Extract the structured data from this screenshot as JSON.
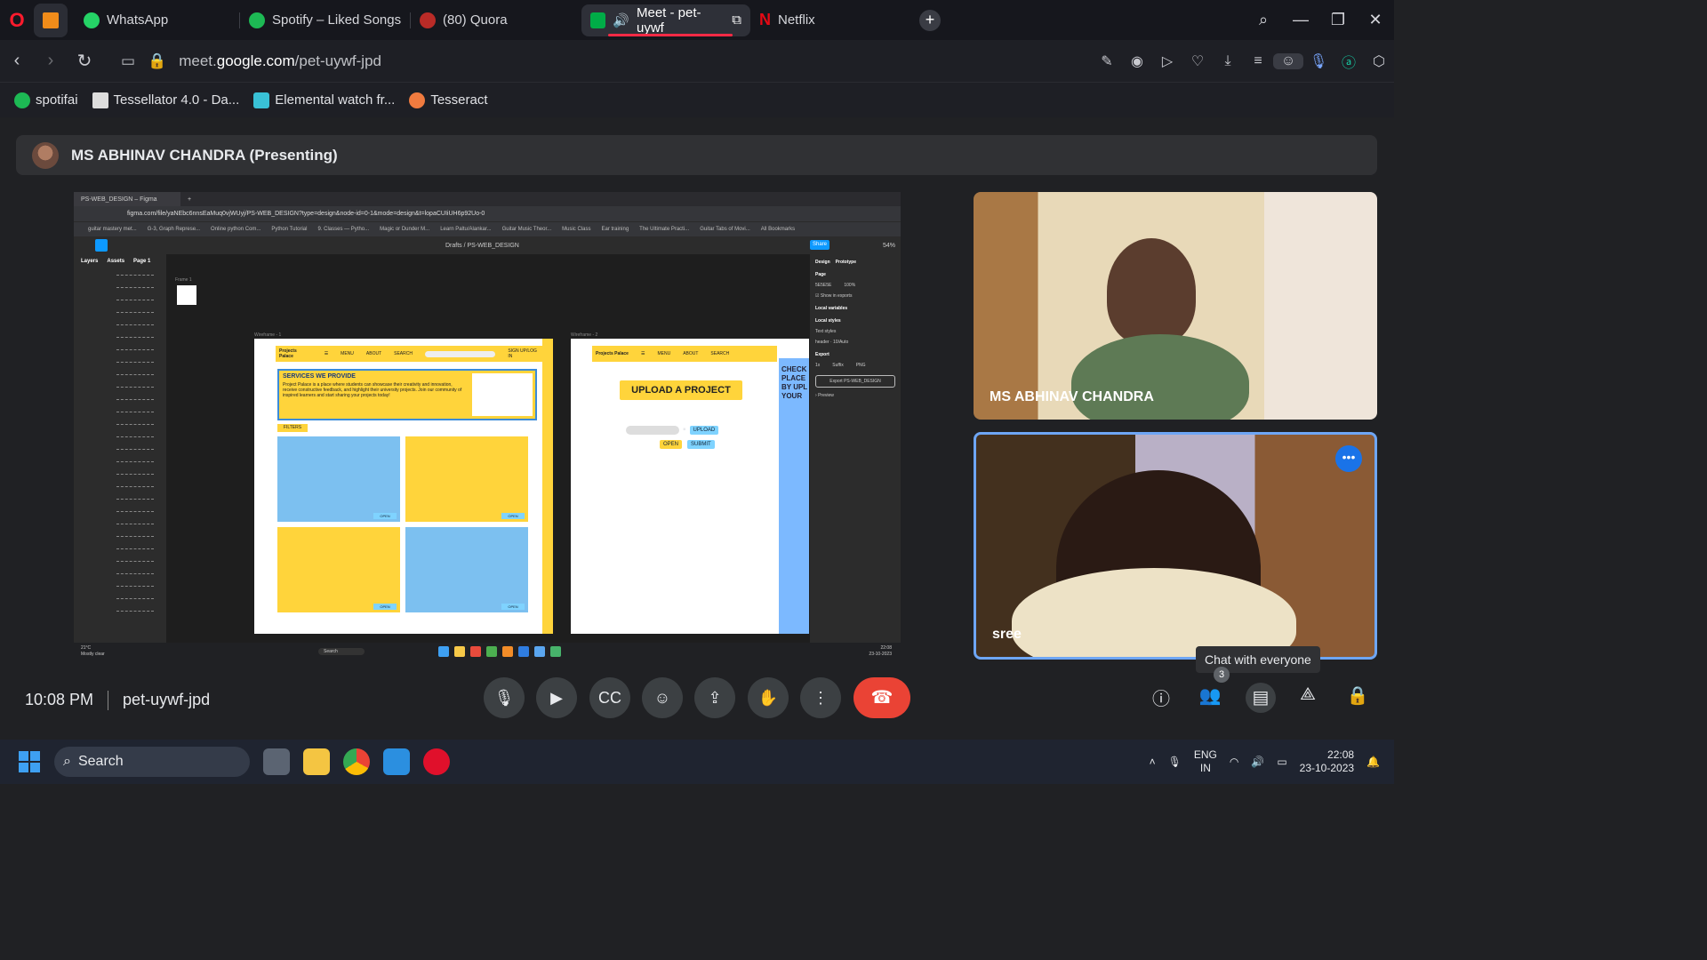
{
  "browser": {
    "tabs": [
      {
        "label": "WhatsApp",
        "icon": "whatsapp-icon",
        "color": "#25d366"
      },
      {
        "label": "Spotify – Liked Songs",
        "icon": "spotify-icon",
        "color": "#1db954"
      },
      {
        "label": "(80) Quora",
        "icon": "quora-icon",
        "color": "#b92b27"
      },
      {
        "label": "Meet - pet-uywf",
        "icon": "meet-icon",
        "color": "#00ac47",
        "active": true
      },
      {
        "label": "Netflix",
        "icon": "netflix-icon",
        "color": "#e50914"
      }
    ],
    "address": {
      "prefix": "meet.",
      "domain": "google.com",
      "path": "/pet-uywf-jpd"
    },
    "bookmarks": [
      {
        "label": "spotifai",
        "color": "#1db954"
      },
      {
        "label": "Tessellator 4.0 - Da...",
        "color": "#dddddd"
      },
      {
        "label": "Elemental watch fr...",
        "color": "#39c1d6"
      },
      {
        "label": "Tesseract",
        "color": "#f07b3f"
      }
    ]
  },
  "meet": {
    "presenter_banner": "MS ABHINAV CHANDRA (Presenting)",
    "time": "10:08 PM",
    "meeting_code": "pet-uywf-jpd",
    "participants": [
      {
        "name": "MS ABHINAV CHANDRA"
      },
      {
        "name": "sree"
      }
    ],
    "tooltip": "Chat with everyone",
    "people_count": "3"
  },
  "shared_screen": {
    "tab_title": "PS-WEB_DESIGN – Figma",
    "url": "figma.com/file/yaNEbc6nnsEaMuq0vjWUyj/PS-WEB_DESIGN?type=design&node-id=0-1&mode=design&t=lopaCUIiUH6p92Uo-0",
    "bookmarks": [
      "guitar mastery met...",
      "G-3, Graph Represe...",
      "Online python Com...",
      "Python Tutorial",
      "9. Classes — Pytho...",
      "Magic or Dunder M...",
      "Learn Paltu/Alankar...",
      "Guitar Music Theor...",
      "Music Class",
      "Ear training",
      "The Ultimate Practi...",
      "Guitar Tabs of Movi...",
      "All Bookmarks"
    ],
    "breadcrumb": "Drafts / PS-WEB_DESIGN",
    "zoom": "54%",
    "share_label": "Share",
    "left_tabs": [
      "Layers",
      "Assets",
      "Page 1"
    ],
    "right_panel": {
      "tabs": [
        "Design",
        "Prototype"
      ],
      "page": "Page",
      "page_color": "5E5E5E",
      "opacity": "100%",
      "show_exports": "Show in exports",
      "local_variables": "Local variables",
      "local_styles": "Local styles",
      "text_styles": "Text styles",
      "text_style_item": "header · 10/Auto",
      "export": "Export",
      "export_scale": "1x",
      "export_suffix": "Suffix",
      "export_format": "PNG",
      "export_button": "Export PS-WEB_DESIGN",
      "preview": "Preview"
    },
    "frame_label": "Frame 1",
    "wireframe1_label": "Wireframe - 1",
    "wireframe2_label": "Wireframe - 2",
    "wf1": {
      "logo": "Projects Palace",
      "menu": "MENU",
      "about": "ABOUT",
      "search": "SEARCH",
      "signup": "SIGN UP/LOG IN",
      "services_title": "SERVICES WE PROVIDE",
      "services_text": "Project Palace is a place where students can showcase their creativity and innovation, receive constructive feedback, and highlight their university projects. Join our community of inspired learners and start sharing your projects today!",
      "filters": "FILTERS",
      "open": "OPEN"
    },
    "wf2": {
      "logo": "Projects Palace",
      "menu": "MENU",
      "about": "ABOUT",
      "search": "SEARCH",
      "upload_title": "UPLOAD A PROJECT",
      "upload_btn": "UPLOAD",
      "open_btn": "OPEN",
      "submit_btn": "SUBMIT",
      "side_text": "CHECK PLACE BY UPL YOUR"
    },
    "status": {
      "weather": "21°C",
      "weather_desc": "Mostly clear",
      "search": "Search",
      "time": "22:08",
      "date": "23-10-2023"
    }
  },
  "taskbar": {
    "search": "Search",
    "lang": "ENG",
    "region": "IN",
    "time": "22:08",
    "date": "23-10-2023"
  }
}
